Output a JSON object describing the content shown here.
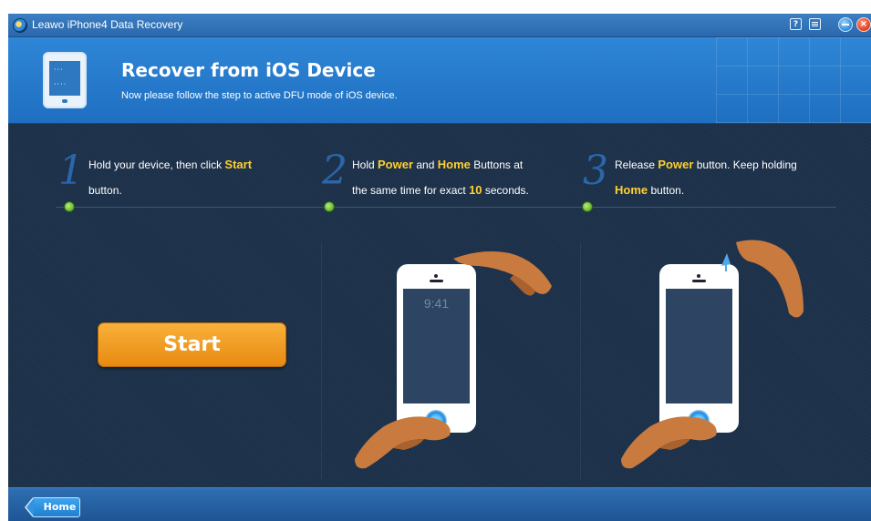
{
  "window": {
    "title": "Leawo iPhone4 Data Recovery"
  },
  "title_bar": {
    "help_icon": "help-icon",
    "menu_icon": "menu-icon",
    "minimize_icon": "minimize-icon",
    "close_icon": "close-icon"
  },
  "header": {
    "title": "Recover from iOS Device",
    "subtitle": "Now please follow the step to active DFU mode of iOS device.",
    "icon": "ipad-device-icon"
  },
  "steps": [
    {
      "number": "1",
      "text_before": "Hold your device, then click ",
      "hl1": "Start",
      "text_after": "button."
    },
    {
      "number": "2",
      "text_a": "Hold ",
      "hl1": "Power",
      "text_b": " and ",
      "hl2": "Home",
      "text_c": " Buttons at",
      "text_d": "the same time for exact ",
      "hl3": "10",
      "text_e": " seconds."
    },
    {
      "number": "3",
      "text_a": "Release ",
      "hl1": "Power",
      "text_b": " button. Keep holding",
      "hl2": "Home",
      "text_c": " button."
    }
  ],
  "start_button": {
    "label": "Start"
  },
  "phone_lock_time": "9:41",
  "footer": {
    "home_button": "Home"
  },
  "colors": {
    "highlight": "#ffd02e",
    "accent_blue": "#1f6fc1",
    "background": "#1c3049",
    "start_button": "#f0991f"
  }
}
